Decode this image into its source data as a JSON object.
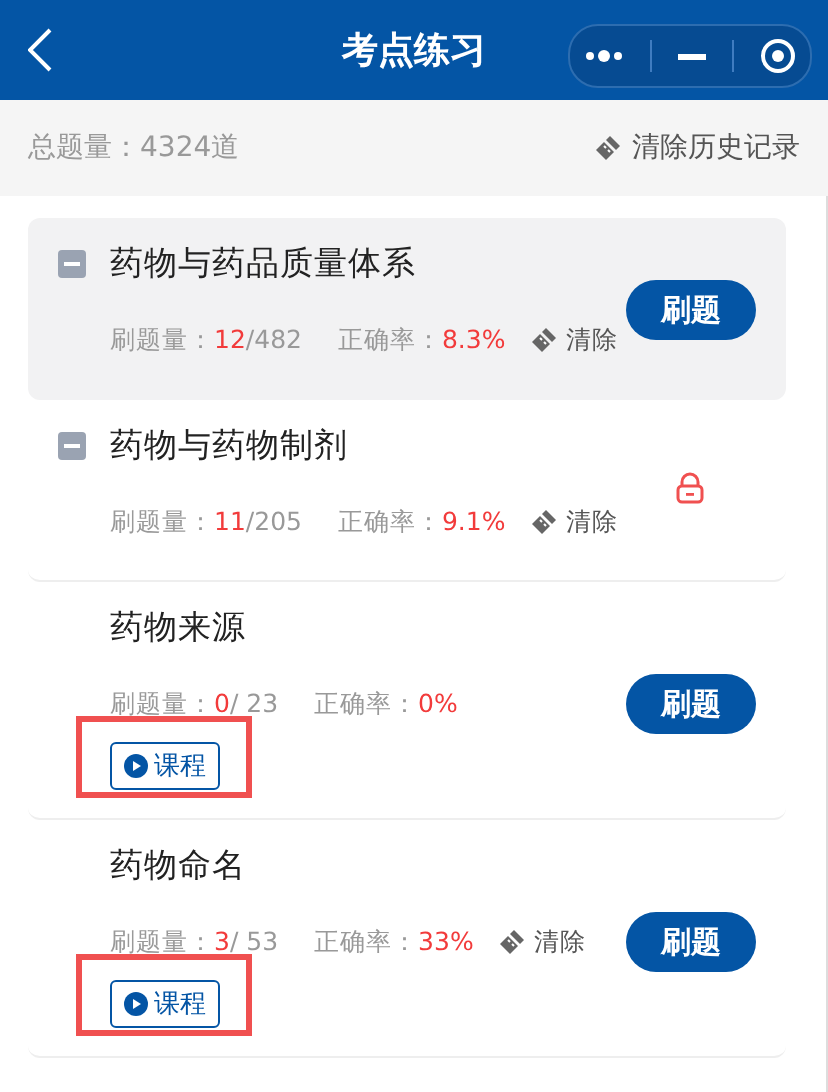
{
  "header": {
    "title": "考点练习"
  },
  "summary": {
    "total_label": "总题量：",
    "total_value": "4324道",
    "clear_history": "清除历史记录"
  },
  "items": [
    {
      "kind": "chapter",
      "title": "药物与药品质量体系",
      "expanded": true,
      "selected": true,
      "done_label": "刷题量：",
      "done": "12",
      "total": "/482",
      "rate_label": "正确率：",
      "rate": "8.3%",
      "clear": "清除",
      "action_label": "刷题"
    },
    {
      "kind": "chapter",
      "title": "药物与药物制剂",
      "expanded": true,
      "selected": false,
      "done_label": "刷题量：",
      "done": "11",
      "total": "/205",
      "rate_label": "正确率：",
      "rate": "9.1%",
      "clear": "清除",
      "locked": true
    },
    {
      "kind": "section",
      "title": "药物来源",
      "selected": false,
      "done_label": "刷题量：",
      "done": "0",
      "total": "/ 23",
      "rate_label": "正确率：",
      "rate": "0%",
      "action_label": "刷题",
      "course": "课程",
      "annotated": true
    },
    {
      "kind": "section",
      "title": "药物命名",
      "selected": false,
      "done_label": "刷题量：",
      "done": "3",
      "total": "/ 53",
      "rate_label": "正确率：",
      "rate": "33%",
      "clear": "清除",
      "action_label": "刷题",
      "course": "课程",
      "annotated": true
    }
  ]
}
